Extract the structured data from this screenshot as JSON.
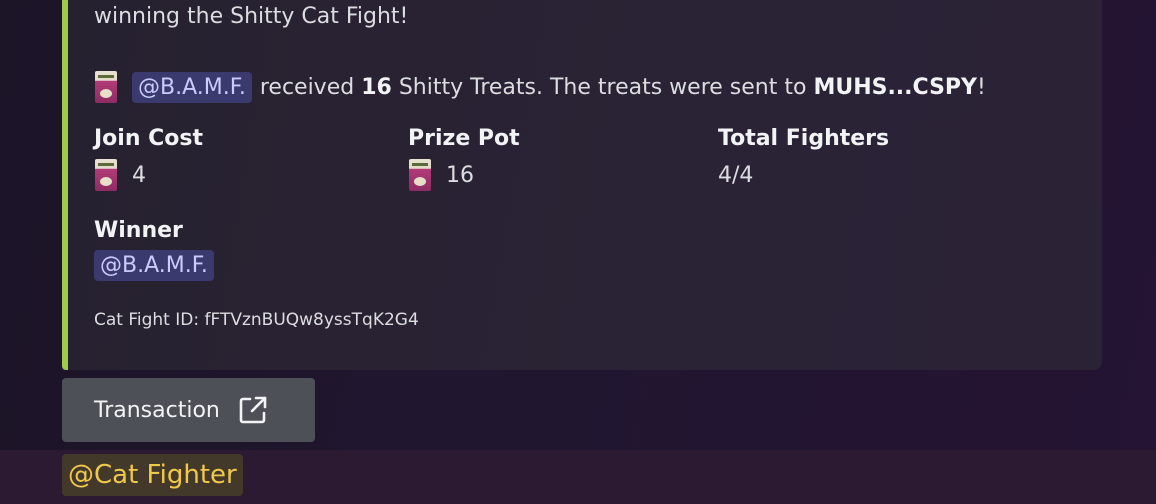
{
  "embed": {
    "accent_color": "#9ccc4a",
    "description_line": "winning the Shitty Cat Fight!",
    "received": {
      "emoji_icon": "shitty-treats-package-icon",
      "mention": "@B.A.M.F.",
      "text_received": "received",
      "amount": "16",
      "text_treats": "Shitty Treats. The treats were sent to",
      "recipient": "MUHS...CSPY",
      "punct": "!"
    },
    "fields": {
      "join_cost": {
        "name": "Join Cost",
        "value": "4"
      },
      "prize_pot": {
        "name": "Prize Pot",
        "value": "16"
      },
      "total_fighters": {
        "name": "Total Fighters",
        "value": "4/4"
      },
      "winner": {
        "name": "Winner",
        "value": "@B.A.M.F."
      }
    },
    "footer": "Cat Fight ID: fFTVznBUQw8yssTqK2G4"
  },
  "button": {
    "label": "Transaction",
    "icon": "external-link-icon"
  },
  "mention_row": {
    "mention": "@Cat Fighter",
    "highlight_color": "#f0c84a"
  }
}
